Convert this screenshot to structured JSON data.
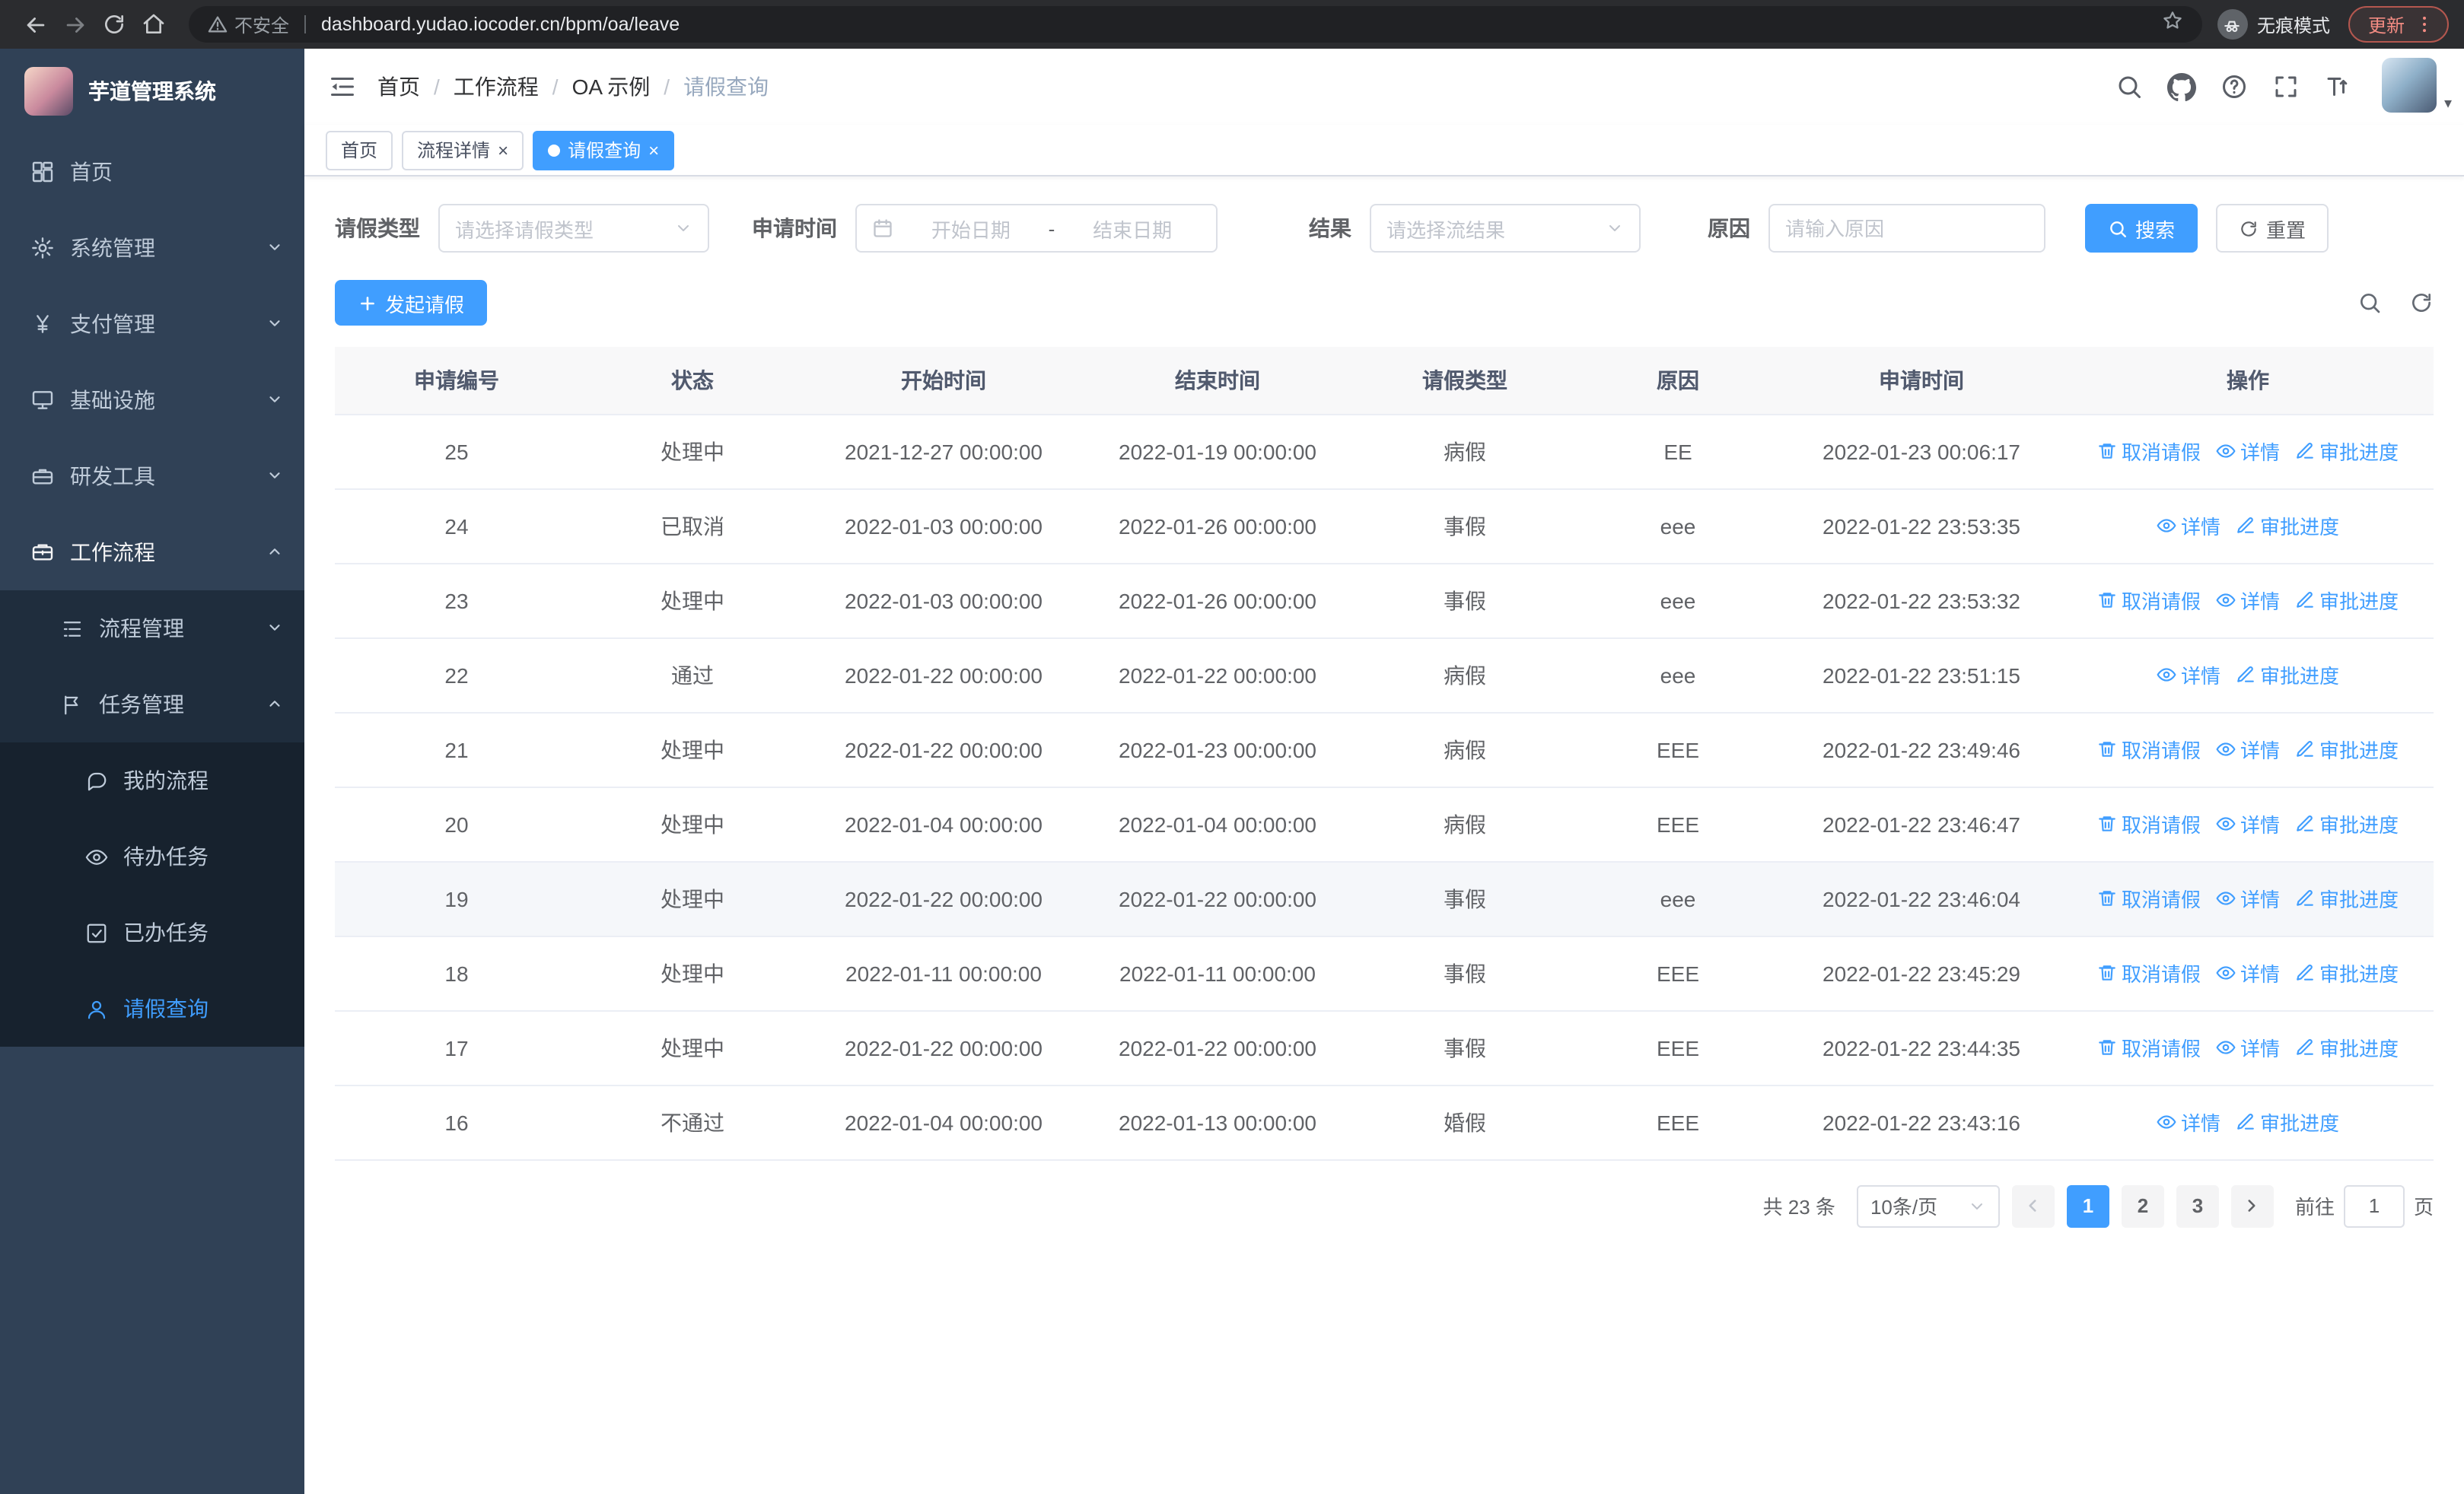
{
  "browser": {
    "security_label": "不安全",
    "url": "dashboard.yudao.iocoder.cn/bpm/oa/leave",
    "incognito_label": "无痕模式",
    "update_label": "更新"
  },
  "sidebar": {
    "logo_title": "芋道管理系统",
    "items": [
      {
        "label": "首页",
        "icon": "dashboard-icon"
      },
      {
        "label": "系统管理",
        "icon": "gear-icon"
      },
      {
        "label": "支付管理",
        "icon": "yen-icon"
      },
      {
        "label": "基础设施",
        "icon": "infra-icon"
      },
      {
        "label": "研发工具",
        "icon": "tool-icon"
      },
      {
        "label": "工作流程",
        "icon": "workflow-icon"
      },
      {
        "label": "流程管理",
        "icon": "process-icon"
      },
      {
        "label": "任务管理",
        "icon": "task-icon"
      },
      {
        "label": "我的流程",
        "icon": "chat-icon"
      },
      {
        "label": "待办任务",
        "icon": "eye-icon"
      },
      {
        "label": "已办任务",
        "icon": "done-icon"
      },
      {
        "label": "请假查询",
        "icon": "user-icon"
      }
    ]
  },
  "header": {
    "breadcrumb": [
      "首页",
      "工作流程",
      "OA 示例",
      "请假查询"
    ]
  },
  "tabs": [
    {
      "label": "首页"
    },
    {
      "label": "流程详情"
    },
    {
      "label": "请假查询"
    }
  ],
  "filters": {
    "leave_type_label": "请假类型",
    "leave_type_placeholder": "请选择请假类型",
    "apply_time_label": "申请时间",
    "start_date_placeholder": "开始日期",
    "range_separator": "-",
    "end_date_placeholder": "结束日期",
    "result_label": "结果",
    "result_placeholder": "请选择流结果",
    "reason_label": "原因",
    "reason_placeholder": "请输入原因",
    "search_button": "搜索",
    "reset_button": "重置"
  },
  "toolbar": {
    "create_button": "发起请假"
  },
  "table": {
    "columns": [
      "申请编号",
      "状态",
      "开始时间",
      "结束时间",
      "请假类型",
      "原因",
      "申请时间",
      "操作"
    ],
    "op_labels": {
      "cancel": "取消请假",
      "detail": "详情",
      "progress": "审批进度"
    },
    "op_icons": {
      "cancel": "trash-icon",
      "detail": "eye-icon",
      "progress": "pen-icon"
    },
    "rows": [
      {
        "id": "25",
        "status": "处理中",
        "start": "2021-12-27 00:00:00",
        "end": "2022-01-19 00:00:00",
        "type": "病假",
        "reason": "EE",
        "apply_time": "2022-01-23 00:06:17",
        "ops": [
          "cancel",
          "detail",
          "progress"
        ]
      },
      {
        "id": "24",
        "status": "已取消",
        "start": "2022-01-03 00:00:00",
        "end": "2022-01-26 00:00:00",
        "type": "事假",
        "reason": "eee",
        "apply_time": "2022-01-22 23:53:35",
        "ops": [
          "detail",
          "progress"
        ]
      },
      {
        "id": "23",
        "status": "处理中",
        "start": "2022-01-03 00:00:00",
        "end": "2022-01-26 00:00:00",
        "type": "事假",
        "reason": "eee",
        "apply_time": "2022-01-22 23:53:32",
        "ops": [
          "cancel",
          "detail",
          "progress"
        ]
      },
      {
        "id": "22",
        "status": "通过",
        "start": "2022-01-22 00:00:00",
        "end": "2022-01-22 00:00:00",
        "type": "病假",
        "reason": "eee",
        "apply_time": "2022-01-22 23:51:15",
        "ops": [
          "detail",
          "progress"
        ]
      },
      {
        "id": "21",
        "status": "处理中",
        "start": "2022-01-22 00:00:00",
        "end": "2022-01-23 00:00:00",
        "type": "病假",
        "reason": "EEE",
        "apply_time": "2022-01-22 23:49:46",
        "ops": [
          "cancel",
          "detail",
          "progress"
        ]
      },
      {
        "id": "20",
        "status": "处理中",
        "start": "2022-01-04 00:00:00",
        "end": "2022-01-04 00:00:00",
        "type": "病假",
        "reason": "EEE",
        "apply_time": "2022-01-22 23:46:47",
        "ops": [
          "cancel",
          "detail",
          "progress"
        ]
      },
      {
        "id": "19",
        "status": "处理中",
        "start": "2022-01-22 00:00:00",
        "end": "2022-01-22 00:00:00",
        "type": "事假",
        "reason": "eee",
        "apply_time": "2022-01-22 23:46:04",
        "ops": [
          "cancel",
          "detail",
          "progress"
        ],
        "hover": true
      },
      {
        "id": "18",
        "status": "处理中",
        "start": "2022-01-11 00:00:00",
        "end": "2022-01-11 00:00:00",
        "type": "事假",
        "reason": "EEE",
        "apply_time": "2022-01-22 23:45:29",
        "ops": [
          "cancel",
          "detail",
          "progress"
        ]
      },
      {
        "id": "17",
        "status": "处理中",
        "start": "2022-01-22 00:00:00",
        "end": "2022-01-22 00:00:00",
        "type": "事假",
        "reason": "EEE",
        "apply_time": "2022-01-22 23:44:35",
        "ops": [
          "cancel",
          "detail",
          "progress"
        ]
      },
      {
        "id": "16",
        "status": "不通过",
        "start": "2022-01-04 00:00:00",
        "end": "2022-01-13 00:00:00",
        "type": "婚假",
        "reason": "EEE",
        "apply_time": "2022-01-22 23:43:16",
        "ops": [
          "detail",
          "progress"
        ]
      }
    ]
  },
  "pagination": {
    "total_label": "共 23 条",
    "page_size": "10条/页",
    "pages": [
      "1",
      "2",
      "3"
    ],
    "active_page": "1",
    "goto_label": "前往",
    "goto_value": "1",
    "page_suffix": "页"
  },
  "colors": {
    "primary": "#409eff",
    "sidebar_bg": "#304156",
    "submenu_bg": "#1f2d3d"
  }
}
